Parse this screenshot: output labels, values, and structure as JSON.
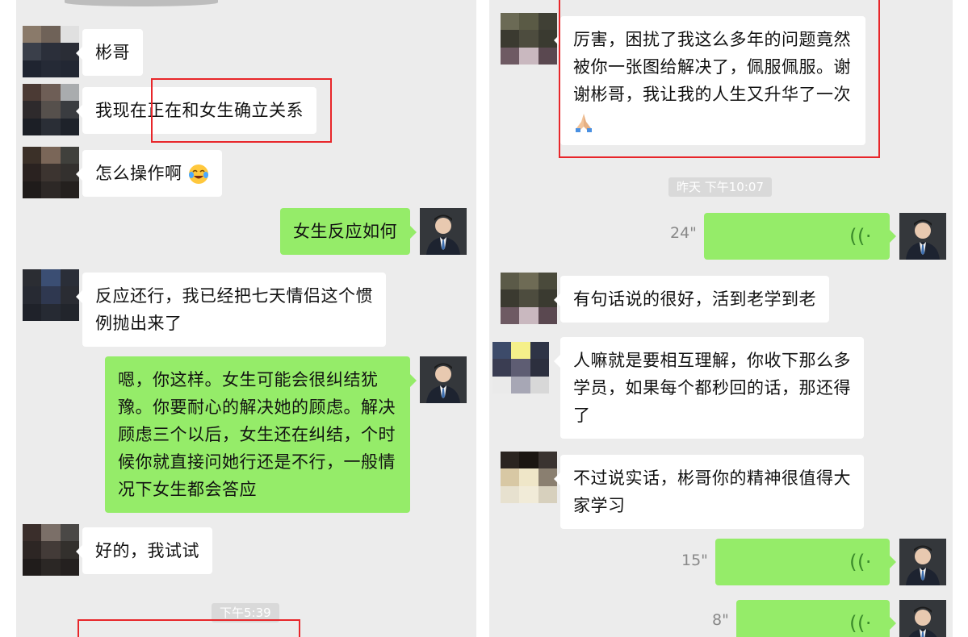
{
  "left": {
    "messages": [
      {
        "text": "彬哥"
      },
      {
        "text": "我现在正在和女生确立关系"
      },
      {
        "text": "怎么操作啊"
      },
      {
        "text": "女生反应如何"
      },
      {
        "text": "反应还行，我已经把七天情侣这个惯例抛出来了"
      },
      {
        "text": "嗯，你这样。女生可能会很纠结犹豫。你要耐心的解决她的顾虑。解决顾虑三个以后，女生还在纠结，个时候你就直接问她行还是不行，一般情况下女生都会答应"
      },
      {
        "text": "好的，我试试"
      }
    ],
    "time_label": "下午5:39"
  },
  "right": {
    "messages": [
      {
        "text": "厉害，困扰了我这么多年的问题竟然被你一张图给解决了，佩服佩服。谢谢彬哥，我让我的人生又升华了一次"
      },
      {
        "text": "有句话说的很好，活到老学到老"
      },
      {
        "text": "人嘛就是要相互理解，你收下那么多学员，如果每个都秒回的话，那还得了"
      },
      {
        "text": "不过说实话，彬哥你的精神很值得大家学习"
      }
    ],
    "time_label": "昨天 下午10:07",
    "voice_durations": [
      "24\"",
      "15\"",
      "8\""
    ]
  },
  "colors": {
    "panel_bg": "#ececec",
    "incoming_bubble": "#ffffff",
    "outgoing_bubble": "#95ec69",
    "highlight_box": "#e8262a"
  },
  "icons": {
    "voice": "voice-wave-icon",
    "crying_laughing": "crying-laughing-emoji",
    "praying_hands": "praying-hands-emoji"
  }
}
